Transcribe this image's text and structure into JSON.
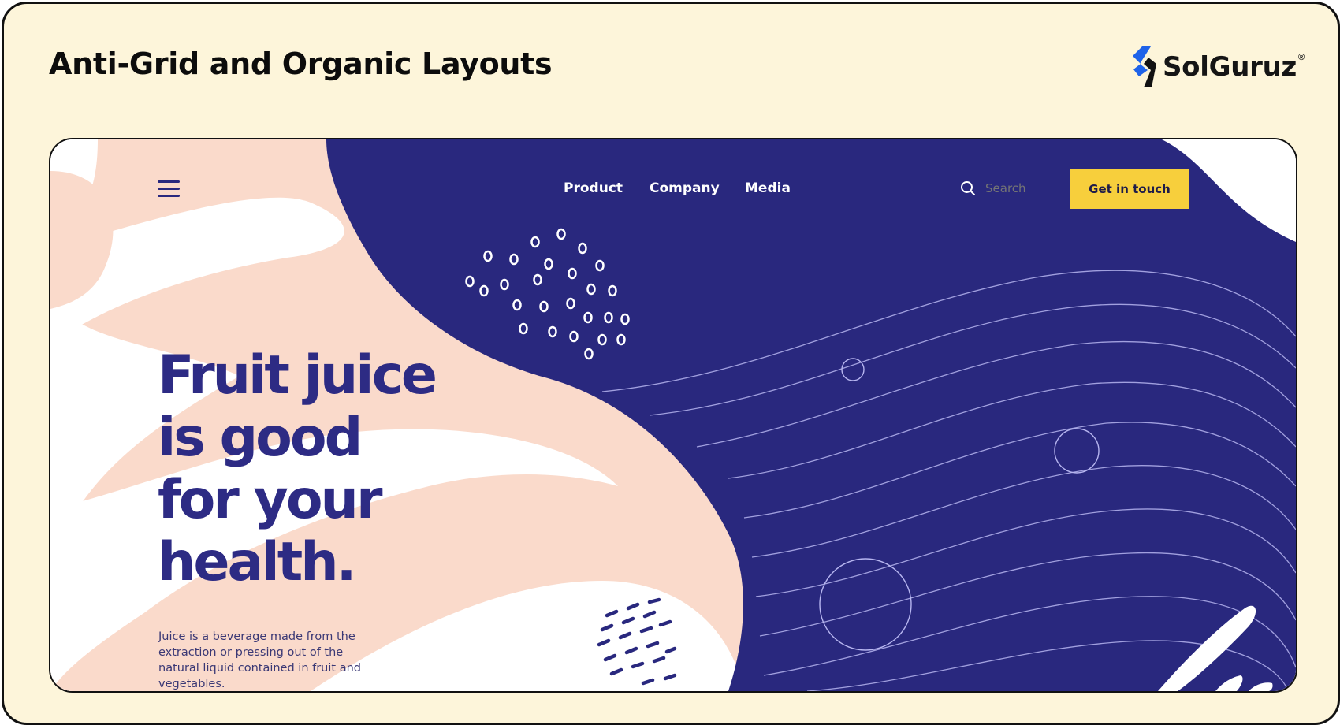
{
  "slide": {
    "title": "Anti-Grid and Organic Layouts",
    "brand": {
      "name": "SolGuruz",
      "registered": "®"
    }
  },
  "website": {
    "nav": {
      "menu_icon": "hamburger-menu-icon",
      "links": [
        "Product",
        "Company",
        "Media"
      ]
    },
    "search": {
      "icon": "search-icon",
      "placeholder": "Search"
    },
    "cta": {
      "label": "Get in touch"
    },
    "hero": {
      "title_lines": [
        "Fruit juice",
        "is good",
        "for your",
        "health."
      ],
      "description": "Juice is a beverage made from the extraction or pressing out of the natural liquid contained in fruit and vegetables."
    }
  },
  "colors": {
    "slide_background": "#fdf5da",
    "navy": "#29287e",
    "peach": "#fadacb",
    "accent_yellow": "#f7cf3c",
    "white": "#ffffff",
    "brand_blue": "#1f63e9"
  }
}
